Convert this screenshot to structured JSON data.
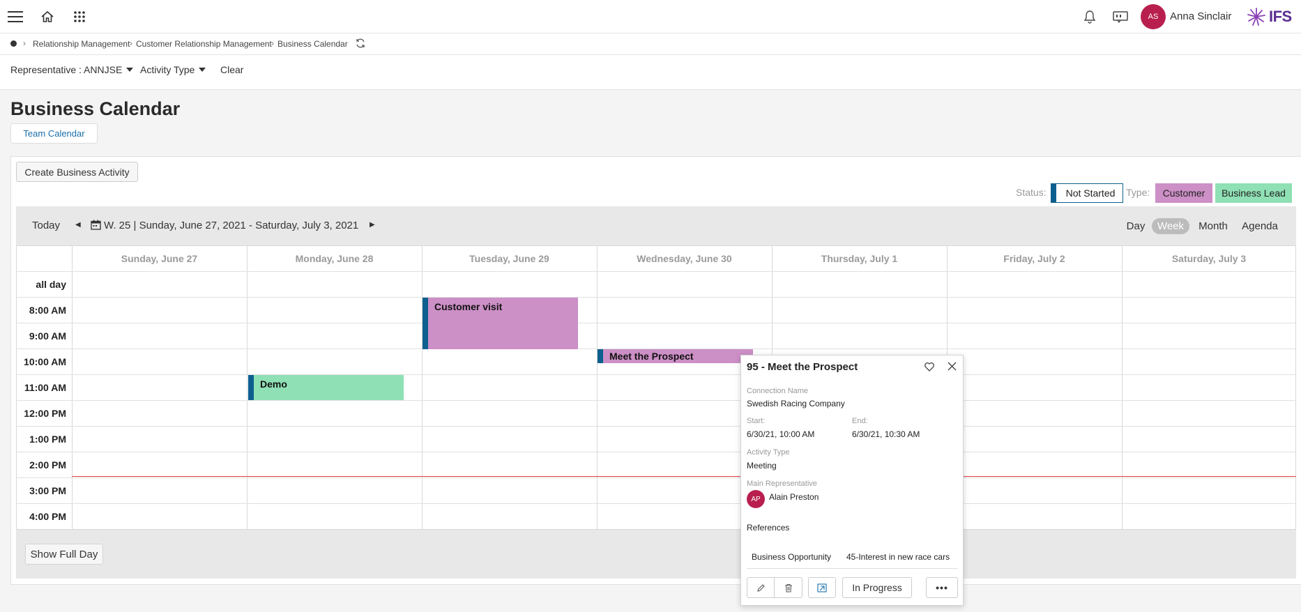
{
  "user": {
    "initials": "AS",
    "name": "Anna Sinclair",
    "avatar_color": "#b81f4f"
  },
  "brand": {
    "logo_text": "IFS"
  },
  "breadcrumb": [
    "Relationship Management",
    "Customer Relationship Management",
    "Business Calendar"
  ],
  "filters": {
    "representative": "Representative : ANNJSE",
    "activity_type": "Activity Type",
    "clear": "Clear"
  },
  "page": {
    "title": "Business Calendar",
    "team_calendar": "Team Calendar",
    "create_button": "Create Business Activity"
  },
  "legend": {
    "status_label": "Status:",
    "not_started": "Not Started",
    "type_label": "Type:",
    "customer": "Customer",
    "business_lead": "Business Lead",
    "colors": {
      "customer": "#cc8fc6",
      "business_lead": "#8fe0b4",
      "status_bar": "#0c5f8e"
    }
  },
  "calendar": {
    "today": "Today",
    "range": "W. 25 | Sunday, June 27, 2021 - Saturday, July 3, 2021",
    "views": [
      "Day",
      "Week",
      "Month",
      "Agenda"
    ],
    "active_view": "Week",
    "days": [
      "Sunday, June 27",
      "Monday, June 28",
      "Tuesday, June 29",
      "Wednesday, June 30",
      "Thursday, July 1",
      "Friday, July 2",
      "Saturday, July 3"
    ],
    "rows": [
      "all day",
      "8:00 AM",
      "9:00 AM",
      "10:00 AM",
      "11:00 AM",
      "12:00 PM",
      "1:00 PM",
      "2:00 PM",
      "3:00 PM",
      "4:00 PM"
    ],
    "events": {
      "customer_visit": "Customer visit",
      "meet_prospect": "Meet the Prospect",
      "demo": "Demo"
    },
    "show_full_day": "Show Full Day"
  },
  "popup": {
    "title": "95 - Meet the Prospect",
    "connection_label": "Connection Name",
    "connection_value": "Swedish Racing Company",
    "start_label": "Start:",
    "start_value": "6/30/21, 10:00 AM",
    "end_label": "End:",
    "end_value": "6/30/21, 10:30 AM",
    "activity_label": "Activity Type",
    "activity_value": "Meeting",
    "rep_label": "Main Representative",
    "rep_initials": "AP",
    "rep_name": "Alain Preston",
    "references_label": "References",
    "ref_type": "Business Opportunity",
    "ref_value": "45-Interest in new race cars",
    "status_button": "In Progress"
  }
}
